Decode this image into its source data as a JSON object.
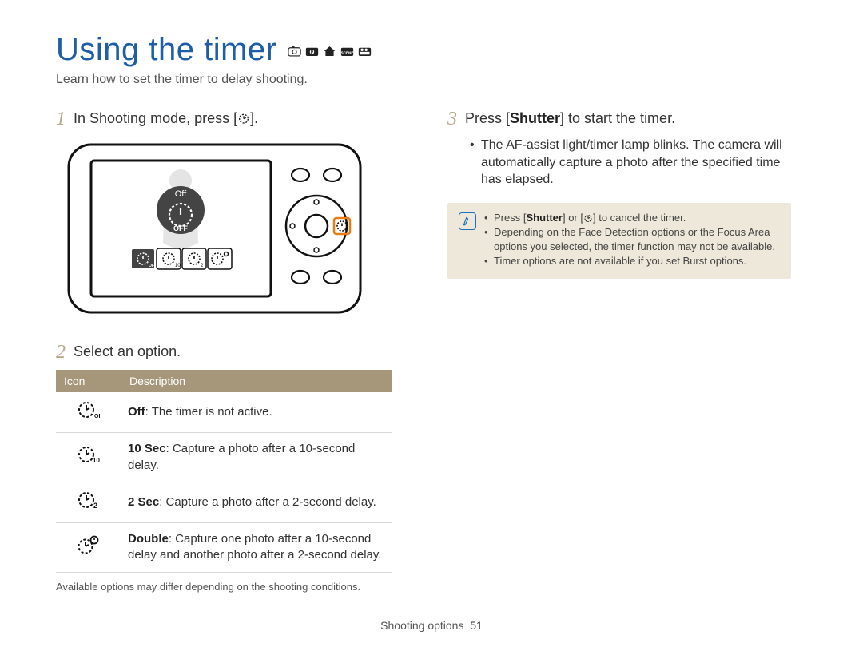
{
  "title": "Using the timer",
  "mode_icons": [
    "smart-icon",
    "program-icon",
    "picture-icon",
    "scene-icon",
    "movie-icon"
  ],
  "subtitle": "Learn how to set the timer to delay shooting.",
  "left": {
    "step1": {
      "num": "1",
      "text_before": "In Shooting mode, press [",
      "text_after": "]."
    },
    "camera_screen_label": "Off",
    "camera_screen_center": "OFF",
    "step2": {
      "num": "2",
      "text": "Select an option."
    },
    "table": {
      "headers": [
        "Icon",
        "Description"
      ],
      "rows": [
        {
          "icon": "timer-off-icon",
          "label": "Off",
          "desc": ": The timer is not active."
        },
        {
          "icon": "timer-10s-icon",
          "label": "10 Sec",
          "desc": ": Capture a photo after a 10-second delay."
        },
        {
          "icon": "timer-2s-icon",
          "label": "2 Sec",
          "desc": ": Capture a photo after a 2-second delay."
        },
        {
          "icon": "timer-double-icon",
          "label": "Double",
          "desc": ": Capture one photo after a 10-second delay and another photo after a 2-second delay."
        }
      ]
    },
    "footnote": "Available options may differ depending on the shooting conditions."
  },
  "right": {
    "step3": {
      "num": "3",
      "text_a": "Press [",
      "text_b": "Shutter",
      "text_c": "] to start the timer."
    },
    "bullets": [
      "The AF-assist light/timer lamp blinks. The camera will automatically capture a photo after the specified time has elapsed."
    ],
    "note": {
      "items": [
        {
          "a": "Press [",
          "b": "Shutter",
          "c": "] or [",
          "d": "] to cancel the timer."
        },
        {
          "text": "Depending on the Face Detection options or the Focus Area options you selected, the timer function may not be available."
        },
        {
          "text": "Timer options are not available if you set Burst options."
        }
      ]
    }
  },
  "footer": {
    "section": "Shooting options",
    "page": "51"
  }
}
